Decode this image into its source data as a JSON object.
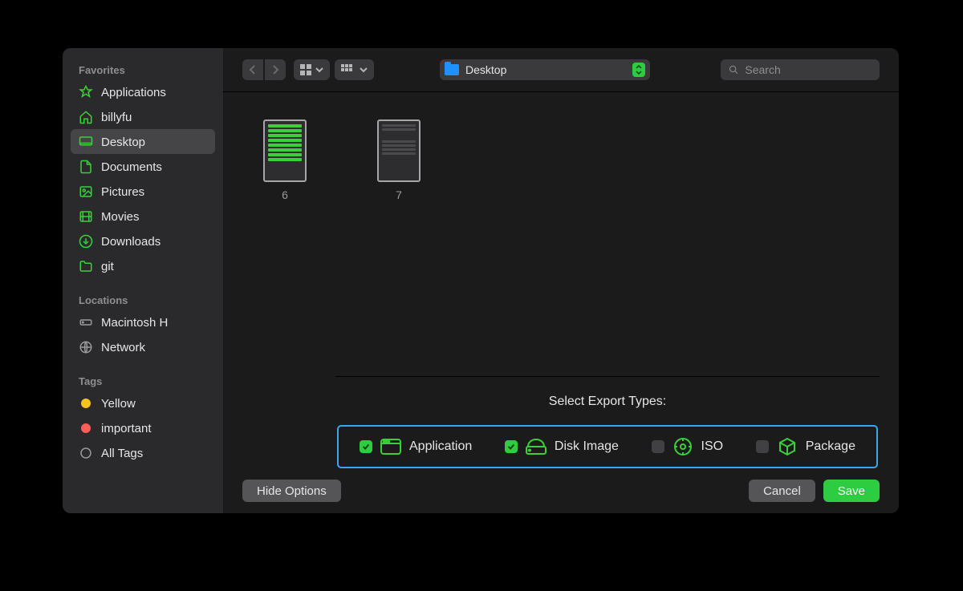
{
  "sidebar": {
    "sections": {
      "favorites": {
        "label": "Favorites",
        "items": [
          {
            "label": "Applications"
          },
          {
            "label": "billyfu"
          },
          {
            "label": "Desktop"
          },
          {
            "label": "Documents"
          },
          {
            "label": "Pictures"
          },
          {
            "label": "Movies"
          },
          {
            "label": "Downloads"
          },
          {
            "label": "git"
          }
        ]
      },
      "locations": {
        "label": "Locations",
        "items": [
          {
            "label": "Macintosh H"
          },
          {
            "label": "Network"
          }
        ]
      },
      "tags": {
        "label": "Tags",
        "items": [
          {
            "label": "Yellow",
            "color": "#f5c518"
          },
          {
            "label": "important",
            "color": "#ff5f57"
          },
          {
            "label": "All Tags"
          }
        ]
      }
    }
  },
  "toolbar": {
    "path": "Desktop",
    "search_placeholder": "Search"
  },
  "files": [
    {
      "name": "6"
    },
    {
      "name": "7"
    }
  ],
  "options": {
    "title": "Select Export Types:",
    "types": [
      {
        "label": "Application",
        "checked": true
      },
      {
        "label": "Disk Image",
        "checked": true
      },
      {
        "label": "ISO",
        "checked": false
      },
      {
        "label": "Package",
        "checked": false
      }
    ]
  },
  "footer": {
    "hide_options": "Hide Options",
    "cancel": "Cancel",
    "save": "Save"
  }
}
